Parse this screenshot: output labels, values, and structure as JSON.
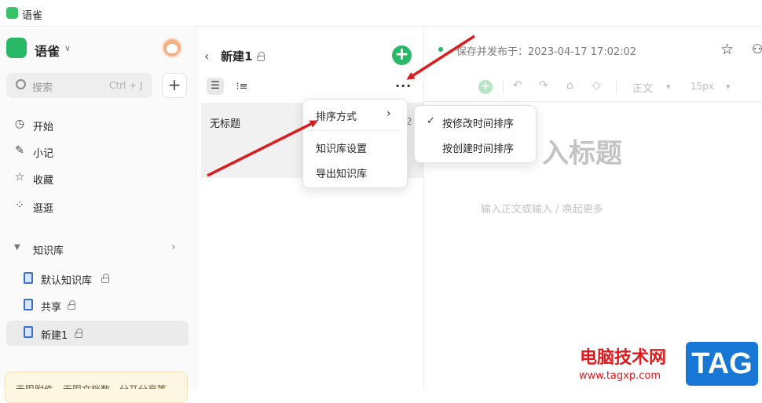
{
  "window": {
    "title": "语雀"
  },
  "sidebar": {
    "app_name": "语雀",
    "caret": "∨",
    "search": {
      "placeholder": "搜索",
      "shortcut": "Ctrl + J"
    },
    "add_label": "+",
    "nav": [
      {
        "label": "开始",
        "icon": "clock-icon",
        "glyph": "◷"
      },
      {
        "label": "小记",
        "icon": "feather-icon",
        "glyph": "✎"
      },
      {
        "label": "收藏",
        "icon": "star-icon",
        "glyph": "☆"
      },
      {
        "label": "逛逛",
        "icon": "grid-icon",
        "glyph": "⁘"
      }
    ],
    "kb_section": {
      "label": "知识库",
      "tri": "▼",
      "chev": "›"
    },
    "kb_items": [
      {
        "label": "默认知识库",
        "locked": true
      },
      {
        "label": "共享",
        "locked": true
      },
      {
        "label": "新建1",
        "locked": true,
        "active": true
      }
    ],
    "promo": "无限附件，无限文档数，分开分享等"
  },
  "doc_pane": {
    "back": "‹",
    "kb_title": "新建1",
    "add_doc": "+",
    "view_list": "☰",
    "view_tree": "⁝≡",
    "more": "···",
    "docs": [
      {
        "title": "无标题",
        "trailing": "2"
      }
    ]
  },
  "editor": {
    "saved_text": "保存并发布于：2023-04-17 17:02:02",
    "star": "☆",
    "share": "⚇",
    "toolbar": {
      "plus": "+",
      "undo": "↶",
      "redo": "↷",
      "format_painter": "⌂",
      "eraser": "◇",
      "style": "正文",
      "size": "15px",
      "dropdown": "▾"
    },
    "title_placeholder": "入标题",
    "body_placeholder": "输入正文或输入 / 唤起更多"
  },
  "menu": {
    "items": [
      {
        "label": "排序方式",
        "arrow": "›"
      },
      {
        "label": "知识库设置"
      },
      {
        "label": "导出知识库"
      }
    ]
  },
  "submenu": {
    "check": "✓",
    "items": [
      {
        "label": "按修改时间排序",
        "checked": true
      },
      {
        "label": "按创建时间排序",
        "checked": false
      }
    ]
  },
  "watermark": {
    "text": "电脑技术网",
    "url": "www.tagxp.com",
    "badge": "TAG"
  },
  "colors": {
    "brand": "#29b866",
    "arrow": "#d81e1e",
    "watermark_red": "#e2191c",
    "watermark_blue": "#1877d4"
  }
}
